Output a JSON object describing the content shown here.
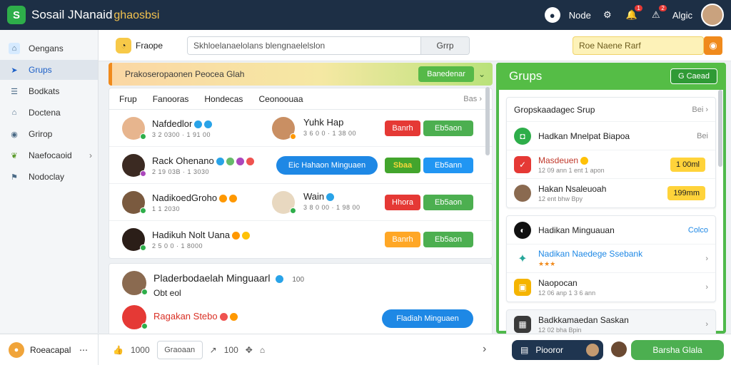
{
  "app": {
    "title": "Sosail JNanaid",
    "subtitle": "ghaosbsi"
  },
  "topbar": {
    "home_label": "Node",
    "notif1": "1",
    "notif2": "2",
    "user_label": "Algic"
  },
  "sidebar": {
    "items": [
      {
        "label": "Oengans"
      },
      {
        "label": "Grups"
      },
      {
        "label": "Bodkats"
      },
      {
        "label": "Doctena"
      },
      {
        "label": "Grirop"
      },
      {
        "label": "Naefocaoid"
      },
      {
        "label": "Nodoclay"
      }
    ]
  },
  "toolbar": {
    "left_label": "Fraope",
    "search_value": "Skhloelanaelolans blengnaelelslon",
    "search_button": "Grrp",
    "right_field": "Roe Naene Rarf"
  },
  "banner": {
    "text": "Prakoseropaonen Peocea Glah",
    "button": "Banedenar"
  },
  "tabs": {
    "items": [
      "Frup",
      "Fanooras",
      "Hondecas",
      "Ceonoouaa"
    ],
    "more": "Bas"
  },
  "rows": [
    {
      "name": "Nafdedlor",
      "meta": "3 2 0300 · 1 91 00",
      "name2": "Yuhk Hap",
      "meta2": "3 6 0 0 · 1 38 00",
      "btn1": "Banrh",
      "btn2": "Eb5aon"
    },
    {
      "name": "Rack Ohenano",
      "meta": "2 19 03B · 1 3030",
      "pill": "Eic Hahaon Minguaen",
      "btn1": "Sbaa",
      "btn2": "Eb5ann"
    },
    {
      "name": "NadikoedGroho",
      "meta": "1 1 2030",
      "name2": "Wain",
      "meta2": "3 8 0 00 · 1 98 00",
      "btn1": "Hhora",
      "btn2": "Eb5aon"
    },
    {
      "name": "Hadikuh Nolt Uana",
      "meta": "2 5 0 0 · 1 8000",
      "btn1": "Banrh",
      "btn2": "Eb5aon"
    }
  ],
  "lower": {
    "name": "Pladerbodaelah Minguaarl",
    "count": "100",
    "sub": "Obt eol",
    "name2": "Ragakan Stebo",
    "pill": "Fladiah Minguaen"
  },
  "right": {
    "title": "Grups",
    "button": "G Caead",
    "box1": {
      "header": "Gropskaadagec Srup",
      "header_more": "Bei",
      "rows": [
        {
          "title": "Hadkan Mnelpat Biapoa",
          "meta": "",
          "more": "Bei"
        },
        {
          "title": "Masdeuen",
          "meta": "12 09 ann 1 ent 1 apon",
          "pill": "1 00ml"
        },
        {
          "title": "Hakan Nsaleuoah",
          "meta": "12 ent bhw Bpy",
          "pill": "199mm"
        }
      ]
    },
    "box2": {
      "rows": [
        {
          "title": "Hadikan Minguauan",
          "meta": "",
          "more": "Colco"
        },
        {
          "title": "Nadikan Naedege Ssebank",
          "meta": "",
          "more": ""
        },
        {
          "title": "Naopocan",
          "meta": "12 06 anp 1 3 6 ann",
          "more": ""
        }
      ]
    },
    "box3": {
      "title": "Badkkamaedan Saskan",
      "meta": "12 02 bha Bpin"
    }
  },
  "bottom": {
    "left_label": "Roeacapal",
    "likes": "1000",
    "input": "Graoaan",
    "shares": "100",
    "dark_btn": "Piooror",
    "green_btn": "Barsha Glala"
  },
  "colors": {
    "accent": "#4caf50",
    "topbar": "#1d2f45",
    "brand_sub": "#f3c24e"
  }
}
